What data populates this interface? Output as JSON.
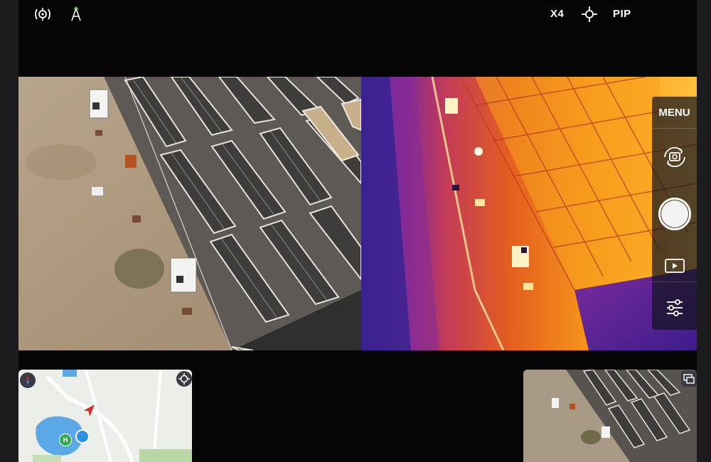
{
  "topbar": {
    "left_icons": [
      "gimbal-target-icon",
      "antenna-signal-icon"
    ],
    "zoom_label": "X4",
    "crosshair_icon": "crosshair-icon",
    "pip_label": "PIP"
  },
  "main_view": {
    "left_pane": "rgb-camera-feed",
    "right_pane": "thermal-camera-feed"
  },
  "control_panel": {
    "menu_label": "MENU",
    "items": [
      "switch-camera-icon",
      "shutter-button",
      "playback-icon",
      "settings-sliders-icon"
    ]
  },
  "minimap": {
    "compass_icon": "compass-icon",
    "locate_icon": "locate-icon",
    "home_marker": "H",
    "aircraft_icon": "aircraft-arrow-icon"
  },
  "preview": {
    "toggle_icon": "display-toggle-icon"
  },
  "colors": {
    "thermal_cold": "#3a1f8f",
    "thermal_mid": "#d4421e",
    "thermal_hot": "#ffb21e",
    "map_water": "#5aa8e6",
    "aircraft_red": "#e02a24",
    "home_green": "#2fa84f"
  }
}
